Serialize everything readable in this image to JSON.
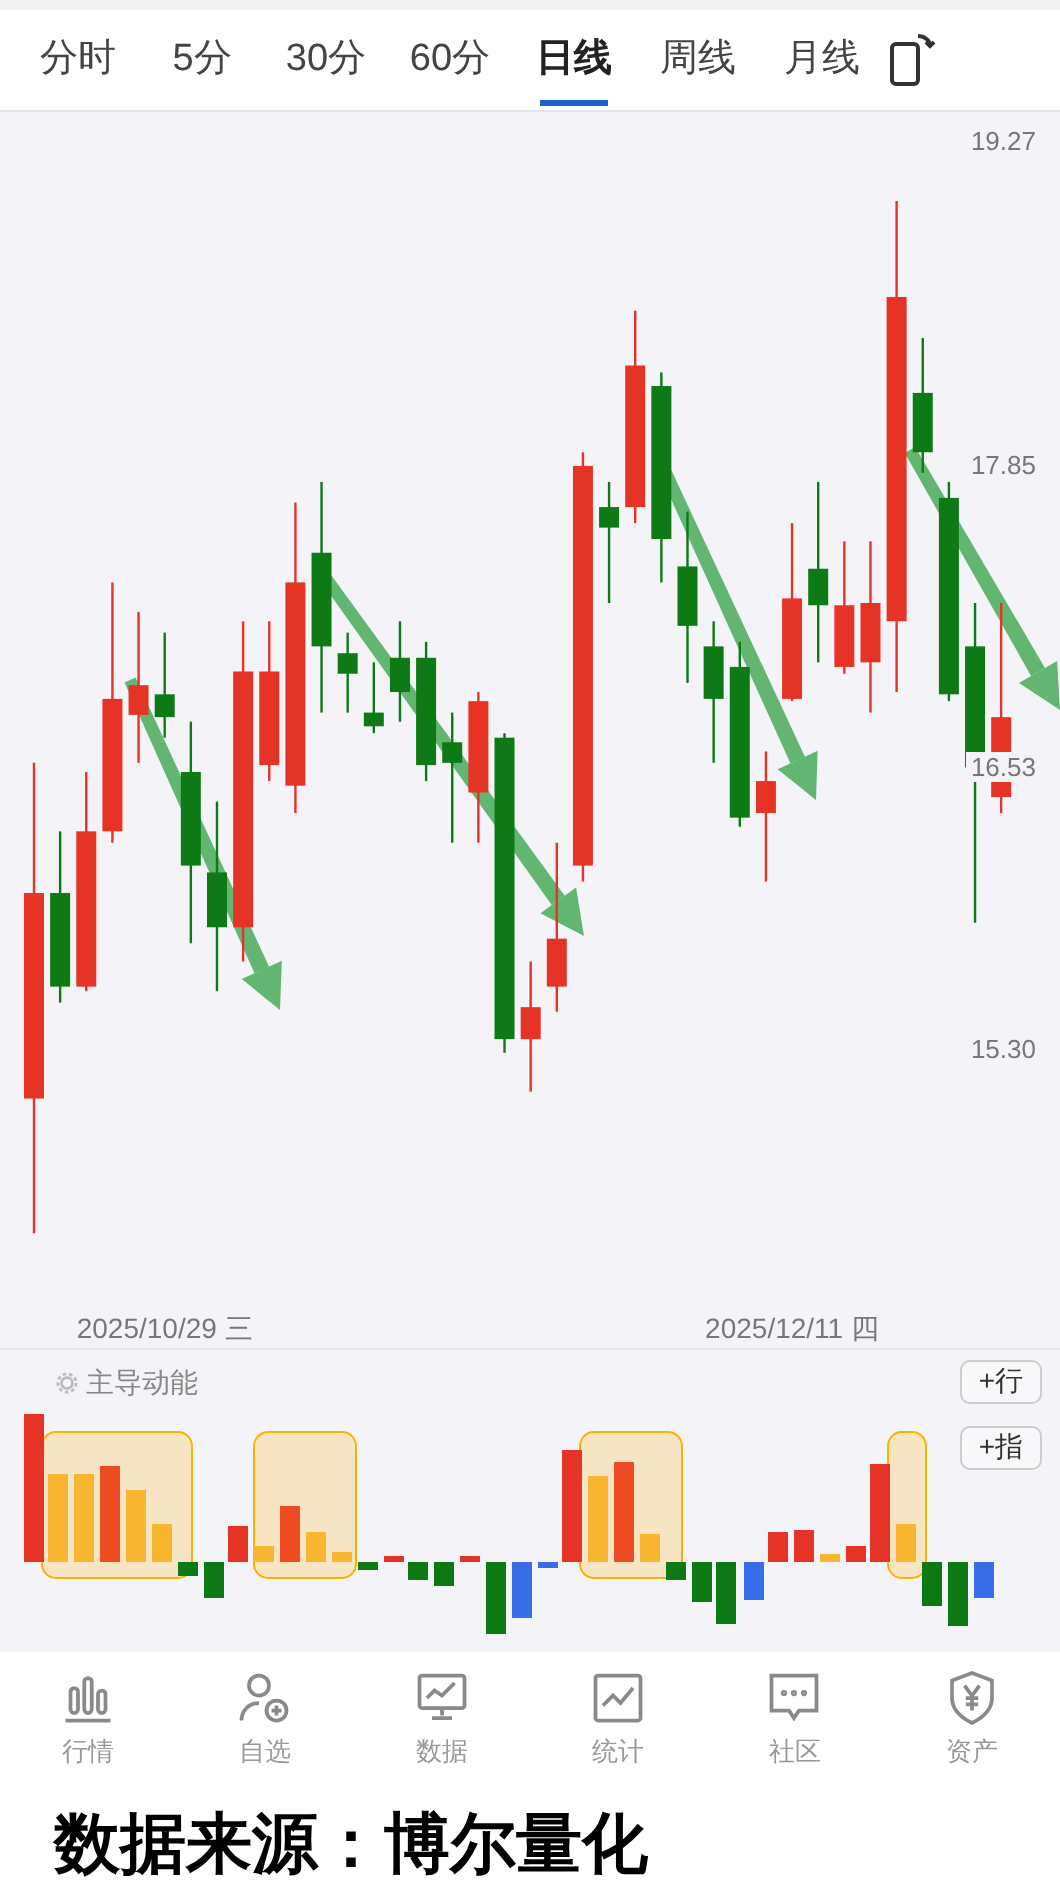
{
  "tabs": [
    {
      "label": "分时",
      "selected": false
    },
    {
      "label": "5分",
      "selected": false
    },
    {
      "label": "30分",
      "selected": false
    },
    {
      "label": "60分",
      "selected": false
    },
    {
      "label": "日线",
      "selected": true
    },
    {
      "label": "周线",
      "selected": false
    },
    {
      "label": "月线",
      "selected": false
    }
  ],
  "chart_data": {
    "type": "candlestick",
    "categories": [
      null,
      null,
      null,
      null,
      null,
      "2025/10/29 三",
      null,
      null,
      null,
      null,
      null,
      null,
      null,
      null,
      null,
      null,
      null,
      null,
      null,
      null,
      null,
      null,
      null,
      null,
      null,
      null,
      null,
      null,
      null,
      "2025/12/11 四",
      null,
      null,
      null,
      null,
      null,
      null,
      null,
      null
    ],
    "ylim": [
      13.97,
      19.4
    ],
    "yticks": [
      {
        "value": 19.27,
        "label": "19.27"
      },
      {
        "value": 17.85,
        "label": "17.85"
      },
      {
        "value": 16.53,
        "label": "16.53"
      },
      {
        "value": 15.3,
        "label": "15.30"
      }
    ],
    "ohlc": [
      [
        15.08,
        16.55,
        14.49,
        15.98
      ],
      [
        15.98,
        16.25,
        15.5,
        15.57
      ],
      [
        15.57,
        16.51,
        15.55,
        16.25
      ],
      [
        16.25,
        17.34,
        16.2,
        16.83
      ],
      [
        16.76,
        17.21,
        16.55,
        16.89
      ],
      [
        16.85,
        17.12,
        16.66,
        16.75
      ],
      [
        16.51,
        16.73,
        15.76,
        16.1
      ],
      [
        16.07,
        16.38,
        15.55,
        15.83
      ],
      [
        15.83,
        17.17,
        15.68,
        16.95
      ],
      [
        16.54,
        17.17,
        16.47,
        16.95
      ],
      [
        16.45,
        17.69,
        16.33,
        17.34
      ],
      [
        17.47,
        17.78,
        16.77,
        17.06
      ],
      [
        17.03,
        17.12,
        16.77,
        16.94
      ],
      [
        16.77,
        16.99,
        16.68,
        16.71
      ],
      [
        17.01,
        17.17,
        16.73,
        16.86
      ],
      [
        17.01,
        17.08,
        16.47,
        16.54
      ],
      [
        16.64,
        16.77,
        16.2,
        16.55
      ],
      [
        16.42,
        16.86,
        16.2,
        16.82
      ],
      [
        16.66,
        16.68,
        15.28,
        15.34
      ],
      [
        15.34,
        15.68,
        15.11,
        15.48
      ],
      [
        15.57,
        16.2,
        15.46,
        15.78
      ],
      [
        16.1,
        17.91,
        16.03,
        17.85
      ],
      [
        17.67,
        17.78,
        17.25,
        17.58
      ],
      [
        17.67,
        18.53,
        17.6,
        18.29
      ],
      [
        18.2,
        18.26,
        17.34,
        17.53
      ],
      [
        17.41,
        17.65,
        16.9,
        17.15
      ],
      [
        17.06,
        17.17,
        16.55,
        16.83
      ],
      [
        16.97,
        17.08,
        16.27,
        16.31
      ],
      [
        16.33,
        16.6,
        16.03,
        16.47
      ],
      [
        16.83,
        17.6,
        16.82,
        17.27
      ],
      [
        17.4,
        17.78,
        16.99,
        17.24
      ],
      [
        16.97,
        17.52,
        16.94,
        17.24
      ],
      [
        16.99,
        17.52,
        16.77,
        17.25
      ],
      [
        17.17,
        19.01,
        16.86,
        18.59
      ],
      [
        18.17,
        18.41,
        17.82,
        17.91
      ],
      [
        17.71,
        17.78,
        16.82,
        16.85
      ],
      [
        17.06,
        17.25,
        15.85,
        16.53
      ],
      [
        16.4,
        17.25,
        16.33,
        16.75
      ]
    ]
  },
  "indicator": {
    "title": "主导动能",
    "buttons": [
      "+行",
      "+指"
    ]
  },
  "nav": [
    {
      "label": "行情",
      "kind": "bars"
    },
    {
      "label": "自选",
      "kind": "user"
    },
    {
      "label": "数据",
      "kind": "monitor"
    },
    {
      "label": "统计",
      "kind": "chart"
    },
    {
      "label": "社区",
      "kind": "chat"
    },
    {
      "label": "资产",
      "kind": "shield"
    }
  ],
  "footer": "数据来源：博尔量化"
}
